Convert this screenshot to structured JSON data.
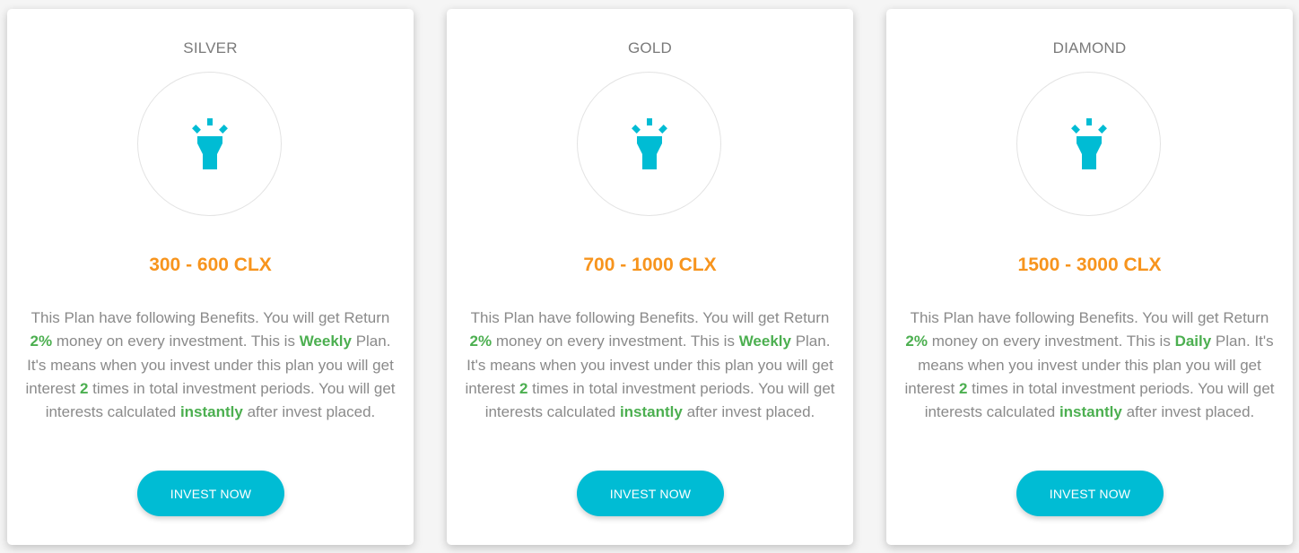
{
  "accent_color": "#00bcd4",
  "range_color": "#f7941d",
  "highlight_color": "#4caf50",
  "plans": [
    {
      "name": "SILVER",
      "icon": "lamp-icon",
      "range": "300 - 600 CLX",
      "description": {
        "t1": "This Plan have following Benefits. You will get Return ",
        "rate": "2%",
        "t2": " money on every investment. This is ",
        "frequency": "Weekly",
        "t3": " Plan. It's means when you invest under this plan you will get interest ",
        "times": "2",
        "t4": " times in total investment periods. You will get interests calculated ",
        "calc": "instantly",
        "t5": " after invest placed."
      },
      "button_label": "INVEST NOW"
    },
    {
      "name": "GOLD",
      "icon": "lamp-icon",
      "range": "700 - 1000 CLX",
      "description": {
        "t1": "This Plan have following Benefits. You will get Return ",
        "rate": "2%",
        "t2": " money on every investment. This is ",
        "frequency": "Weekly",
        "t3": " Plan. It's means when you invest under this plan you will get interest ",
        "times": "2",
        "t4": " times in total investment periods. You will get interests calculated ",
        "calc": "instantly",
        "t5": " after invest placed."
      },
      "button_label": "INVEST NOW"
    },
    {
      "name": "DIAMOND",
      "icon": "lamp-icon",
      "range": "1500 - 3000 CLX",
      "description": {
        "t1": "This Plan have following Benefits. You will get Return ",
        "rate": "2%",
        "t2": " money on every investment. This is ",
        "frequency": "Daily",
        "t3": " Plan. It's means when you invest under this plan you will get interest ",
        "times": "2",
        "t4": " times in total investment periods. You will get interests calculated ",
        "calc": "instantly",
        "t5": " after invest placed."
      },
      "button_label": "INVEST NOW"
    }
  ]
}
